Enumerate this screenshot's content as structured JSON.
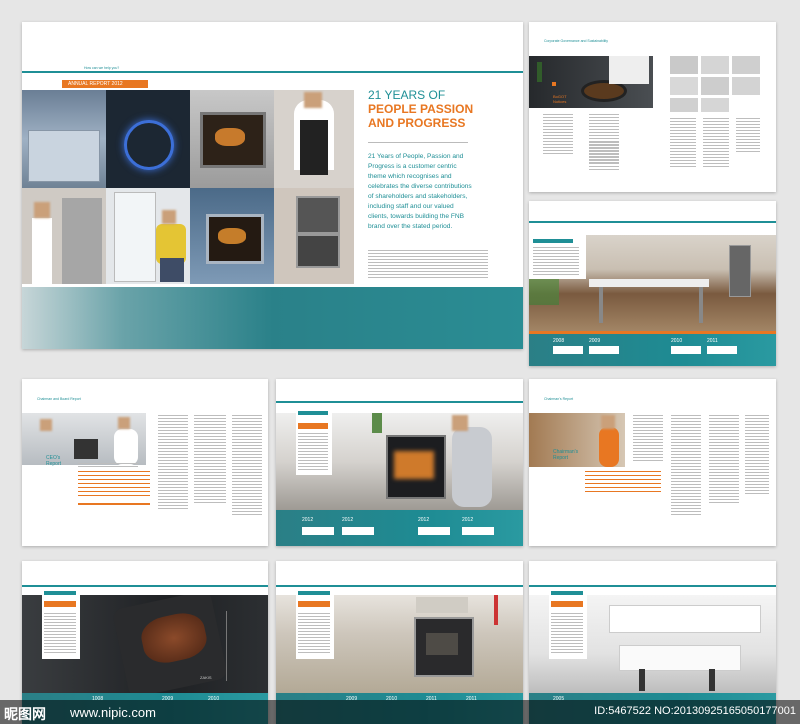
{
  "cover": {
    "top_label": "How can we help you?",
    "annual_report_prefix": "ANNUAL",
    "annual_report_word": "REPORT 2012",
    "title_line1": "21 YEARS OF",
    "title_line2": "PEOPLE PASSION",
    "title_line3": "AND PROGRESS",
    "intro_p1": "21 Years of People, Passion and",
    "intro_p2": "Progress is a customer centric",
    "intro_p3": "theme which recognises and",
    "intro_p4": "celebrates the diverse contributions",
    "intro_p5": "of shareholders and stakeholders,",
    "intro_p6": "including staff and our valued",
    "intro_p7": "clients, towards building the FNB",
    "intro_p8": "brand over the stated period."
  },
  "page_gov": {
    "header": "Corporate Governance and Sustainability",
    "label_line1": "BoGOT",
    "label_line2": "Notices"
  },
  "page_ceo": {
    "header": "Chairman and Board Report",
    "label_line1": "CEO's",
    "label_line2": "Report"
  },
  "page_chair": {
    "header": "Chairman's Report",
    "label_line1": "Chairman's",
    "label_line2": "Report"
  },
  "timelines": {
    "kitchen": [
      "2008",
      "2009",
      "2010",
      "2011"
    ],
    "oven": [
      "2012",
      "2012",
      "2012",
      "2012"
    ],
    "steak": [
      "1008",
      "2009",
      "2010"
    ],
    "stove": [
      "2009",
      "2010",
      "2011",
      "2011"
    ],
    "white": [
      "2005"
    ]
  },
  "steak_caption": "ZAKIS",
  "watermark": {
    "logo": "昵图网",
    "site": "www.nipic.com",
    "id": "ID:5467522 NO:20130925165050177001"
  },
  "colors": {
    "teal": "#1f8f96",
    "orange": "#e87722"
  }
}
